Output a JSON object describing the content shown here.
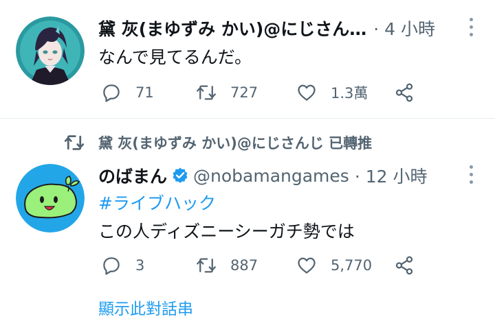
{
  "tweets": [
    {
      "display_name": "黛 灰(まゆずみ かい)@にじさん…",
      "handle": "",
      "time": "· 4 小時",
      "text": "なんで見てるんだ。",
      "reply_count": "71",
      "retweet_count": "727",
      "like_count": "1.3萬",
      "avatar": "anime-character-avatar"
    },
    {
      "retweeted_by": "黛 灰(まゆずみ かい)@にじさんじ 已轉推",
      "display_name": "のばまん",
      "verified": true,
      "handle": "@nobamangames",
      "time": "· 12 小時",
      "hashtag": "#ライブハック",
      "text": "この人ディズニーシーガチ勢では",
      "reply_count": "3",
      "retweet_count": "887",
      "like_count": "5,770",
      "avatar": "green-slime-avatar",
      "show_thread": "顯示此對話串"
    }
  ],
  "icons": {
    "reply": "reply-icon",
    "retweet": "retweet-icon",
    "like": "heart-icon",
    "share": "share-icon",
    "more": "more-vertical-icon",
    "verified": "verified-badge-icon"
  },
  "colors": {
    "accent": "#1d9bf0",
    "secondary_text": "#536471",
    "primary_text": "#0f1419",
    "divider": "#e6ecf0"
  }
}
